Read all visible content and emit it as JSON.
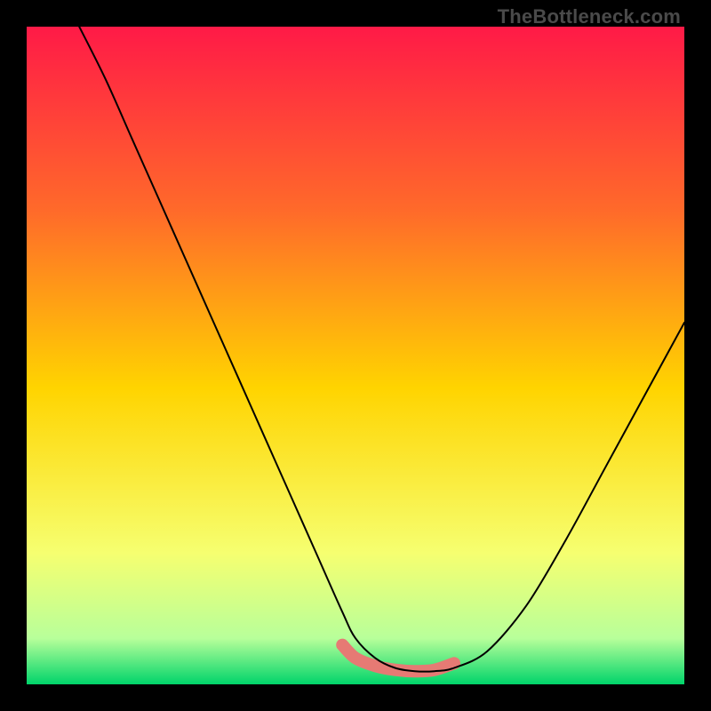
{
  "watermark": "TheBottleneck.com",
  "chart_data": {
    "type": "line",
    "title": "",
    "xlabel": "",
    "ylabel": "",
    "xlim": [
      0,
      100
    ],
    "ylim": [
      0,
      100
    ],
    "gradient_colors": {
      "top": "#ff1a47",
      "upper_mid": "#ff6a2a",
      "mid": "#ffd400",
      "lower_mid": "#f6ff70",
      "lower": "#b8ff9a",
      "bottom": "#00d46a"
    },
    "series": [
      {
        "name": "bottleneck-curve",
        "color": "#000000",
        "x": [
          8,
          12,
          16,
          20,
          24,
          28,
          32,
          36,
          40,
          44,
          48,
          50,
          53,
          56,
          59,
          62,
          65,
          70,
          76,
          82,
          88,
          94,
          100
        ],
        "y": [
          100,
          92,
          83,
          74,
          65,
          56,
          47,
          38,
          29,
          20,
          11,
          7,
          4,
          2.5,
          2,
          2,
          2.5,
          5,
          12,
          22,
          33,
          44,
          55
        ]
      },
      {
        "name": "highlight-band",
        "color": "#e67a74",
        "x": [
          48,
          50,
          53,
          56,
          59,
          62,
          65
        ],
        "y": [
          6,
          4,
          2.8,
          2.2,
          2.0,
          2.2,
          3.2
        ]
      }
    ],
    "annotations": []
  }
}
